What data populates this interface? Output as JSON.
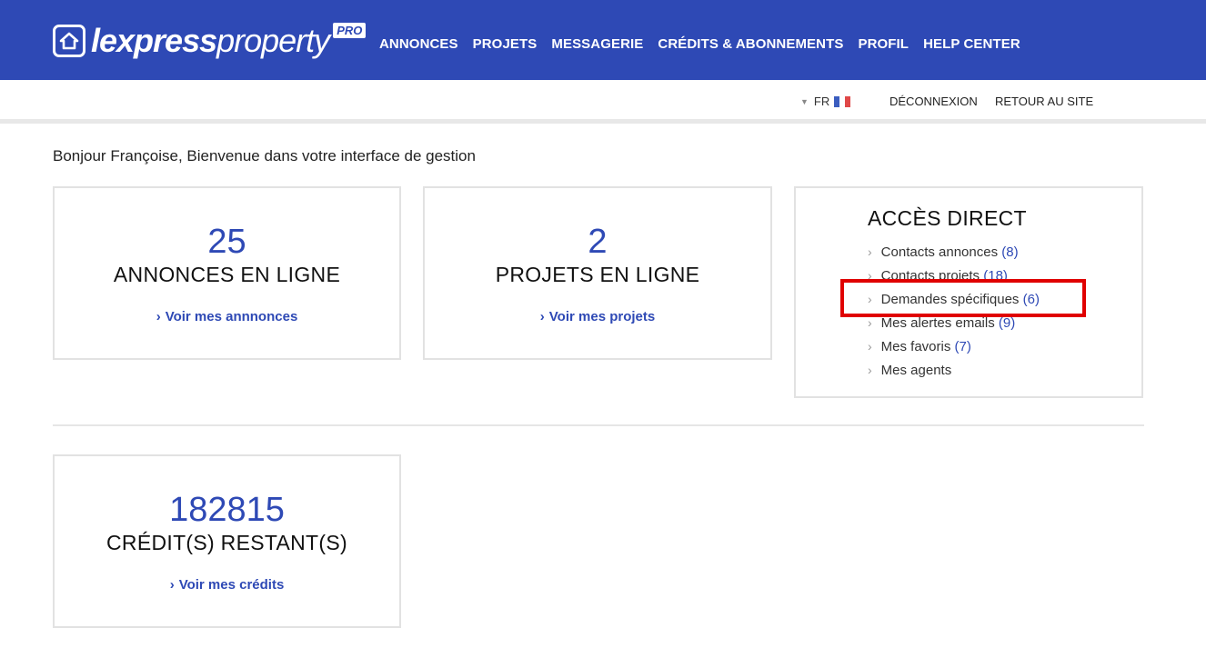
{
  "brand": {
    "name_bold": "lexpress",
    "name_light": "property",
    "badge": "PRO"
  },
  "nav": [
    {
      "label": "ANNONCES"
    },
    {
      "label": "PROJETS"
    },
    {
      "label": "MESSAGERIE"
    },
    {
      "label": "CRÉDITS & ABONNEMENTS"
    },
    {
      "label": "PROFIL"
    },
    {
      "label": "HELP CENTER"
    }
  ],
  "subbar": {
    "language": "FR",
    "logout": "DÉCONNEXION",
    "back": "RETOUR AU SITE"
  },
  "greeting": "Bonjour Françoise, Bienvenue dans votre interface de gestion",
  "cards": {
    "listings": {
      "count": "25",
      "label": "ANNONCES EN LIGNE",
      "link": "Voir mes annnonces"
    },
    "projects": {
      "count": "2",
      "label": "PROJETS EN LIGNE",
      "link": "Voir mes projets"
    },
    "credits": {
      "count": "182815",
      "label": "CRÉDIT(S) RESTANT(S)",
      "link": "Voir mes crédits"
    }
  },
  "direct_access": {
    "title": "ACCÈS DIRECT",
    "items": [
      {
        "label": "Contacts annonces",
        "count": "(8)"
      },
      {
        "label": "Contacts projets",
        "count": "(18)"
      },
      {
        "label": "Demandes spécifiques",
        "count": "(6)"
      },
      {
        "label": "Mes alertes emails",
        "count": "(9)"
      },
      {
        "label": "Mes favoris",
        "count": "(7)"
      },
      {
        "label": "Mes agents",
        "count": ""
      }
    ]
  },
  "colors": {
    "brand_blue": "#2e49b5",
    "highlight_red": "#e00000"
  },
  "icons": {
    "chevron": "chevron-right-icon",
    "flag": "france-flag-icon",
    "caret": "caret-down-icon"
  }
}
